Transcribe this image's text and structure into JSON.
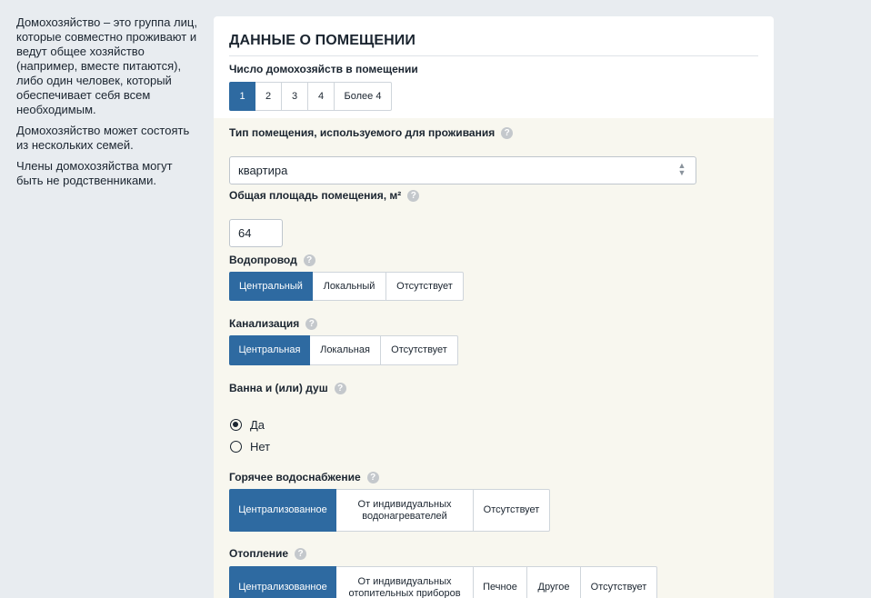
{
  "sidebar": {
    "paragraphs": [
      "Домохозяйство – это группа лиц, которые совместно проживают и ведут общее хозяйство (например, вместе питаются), либо один человек, который обеспечивает себя всем необходимым.",
      "Домохозяйство может состоять из нескольких семей.",
      "Члены домохозяйства могут быть не родственниками."
    ]
  },
  "card": {
    "title": "ДАННЫЕ О ПОМЕЩЕНИИ",
    "households": {
      "label": "Число домохозяйств в помещении",
      "options": [
        "1",
        "2",
        "3",
        "4",
        "Более 4"
      ],
      "selected": "1"
    },
    "room_type": {
      "label": "Тип помещения, используемого для проживания",
      "value": "квартира"
    },
    "area": {
      "label": "Общая площадь помещения, м²",
      "value": "64"
    },
    "water": {
      "label": "Водопровод",
      "options": [
        "Центральный",
        "Локальный",
        "Отсутствует"
      ],
      "selected": "Центральный"
    },
    "sewage": {
      "label": "Канализация",
      "options": [
        "Центральная",
        "Локальная",
        "Отсутствует"
      ],
      "selected": "Центральная"
    },
    "bath": {
      "label": "Ванна и (или) душ",
      "options": [
        "Да",
        "Нет"
      ],
      "selected": "Да"
    },
    "hot_water": {
      "label": "Горячее водоснабжение",
      "options": [
        "Централизованное",
        "От индивидуальных водонагревателей",
        "Отсутствует"
      ],
      "selected": "Централизованное"
    },
    "heating": {
      "label": "Отопление",
      "options": [
        "Централизованное",
        "От индивидуальных отопительных приборов",
        "Печное",
        "Другое",
        "Отсутствует"
      ],
      "selected": "Централизованное"
    },
    "help_icon_glyph": "?"
  },
  "colors": {
    "accent": "#2e6aa1",
    "page_bg": "#e8ecf0",
    "section_bg": "#f8f7ef"
  }
}
